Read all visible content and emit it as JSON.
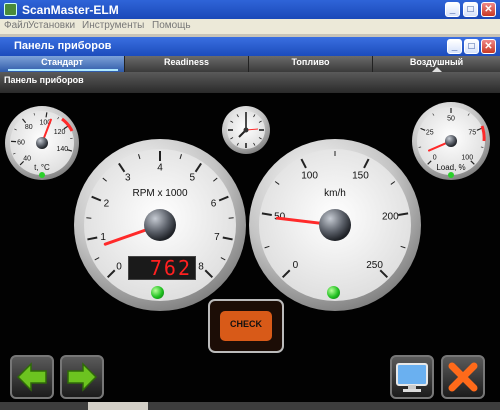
{
  "app": {
    "title": "ScanMaster-ELM",
    "menu": [
      "Файл",
      "Установки",
      "Инструменты",
      "Помощь"
    ]
  },
  "window": {
    "title": "Панель приборов"
  },
  "tabs": [
    {
      "label": "Стандарт",
      "active": true
    },
    {
      "label": "Readiness",
      "active": false
    },
    {
      "label": "Топливо",
      "active": false
    },
    {
      "label": "Воздушный",
      "active": false
    }
  ],
  "section_title": "Панель приборов",
  "gauges": {
    "temp": {
      "unit_label": "t, °C",
      "ticks": [
        "40",
        "60",
        "80",
        "100",
        "120",
        "140"
      ],
      "value": 105
    },
    "load": {
      "unit_label": "Load, %",
      "ticks": [
        "0",
        "25",
        "50",
        "75",
        "100"
      ],
      "value": 8
    },
    "rpm": {
      "unit_label": "RPM x 1000",
      "ticks": [
        "0",
        "1",
        "2",
        "3",
        "4",
        "5",
        "6",
        "7",
        "8"
      ],
      "value": 0.762,
      "readout": "762"
    },
    "speed": {
      "unit_label": "km/h",
      "ticks": [
        "0",
        "50",
        "100",
        "150",
        "200",
        "250"
      ],
      "value": 48
    }
  },
  "check_engine": {
    "label": "CHECK"
  },
  "buttons": {
    "back": "back-arrow-icon",
    "forward": "forward-arrow-icon",
    "monitor": "monitor-icon",
    "close": "close-x-icon"
  },
  "colors": {
    "needle": "#ff2a2a",
    "readout": "#ff2020",
    "check_engine": "#d85a18",
    "arrow_green": "#6cc320",
    "close_orange": "#ff6a1a",
    "title_bar": "#2456c8"
  }
}
